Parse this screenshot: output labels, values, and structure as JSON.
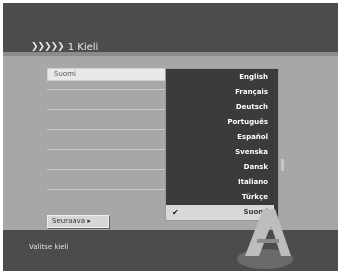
{
  "header": {
    "title": "1 Kieli"
  },
  "field": {
    "value": "Suomi"
  },
  "languages": [
    "English",
    "Français",
    "Deutsch",
    "Português",
    "Español",
    "Svenska",
    "Dansk",
    "Italiano",
    "Türkçe",
    "Suomi"
  ],
  "selected_language": "Suomi",
  "next_button": {
    "label": "Seuraava"
  },
  "footer": {
    "hint": "Valitse kieli"
  }
}
